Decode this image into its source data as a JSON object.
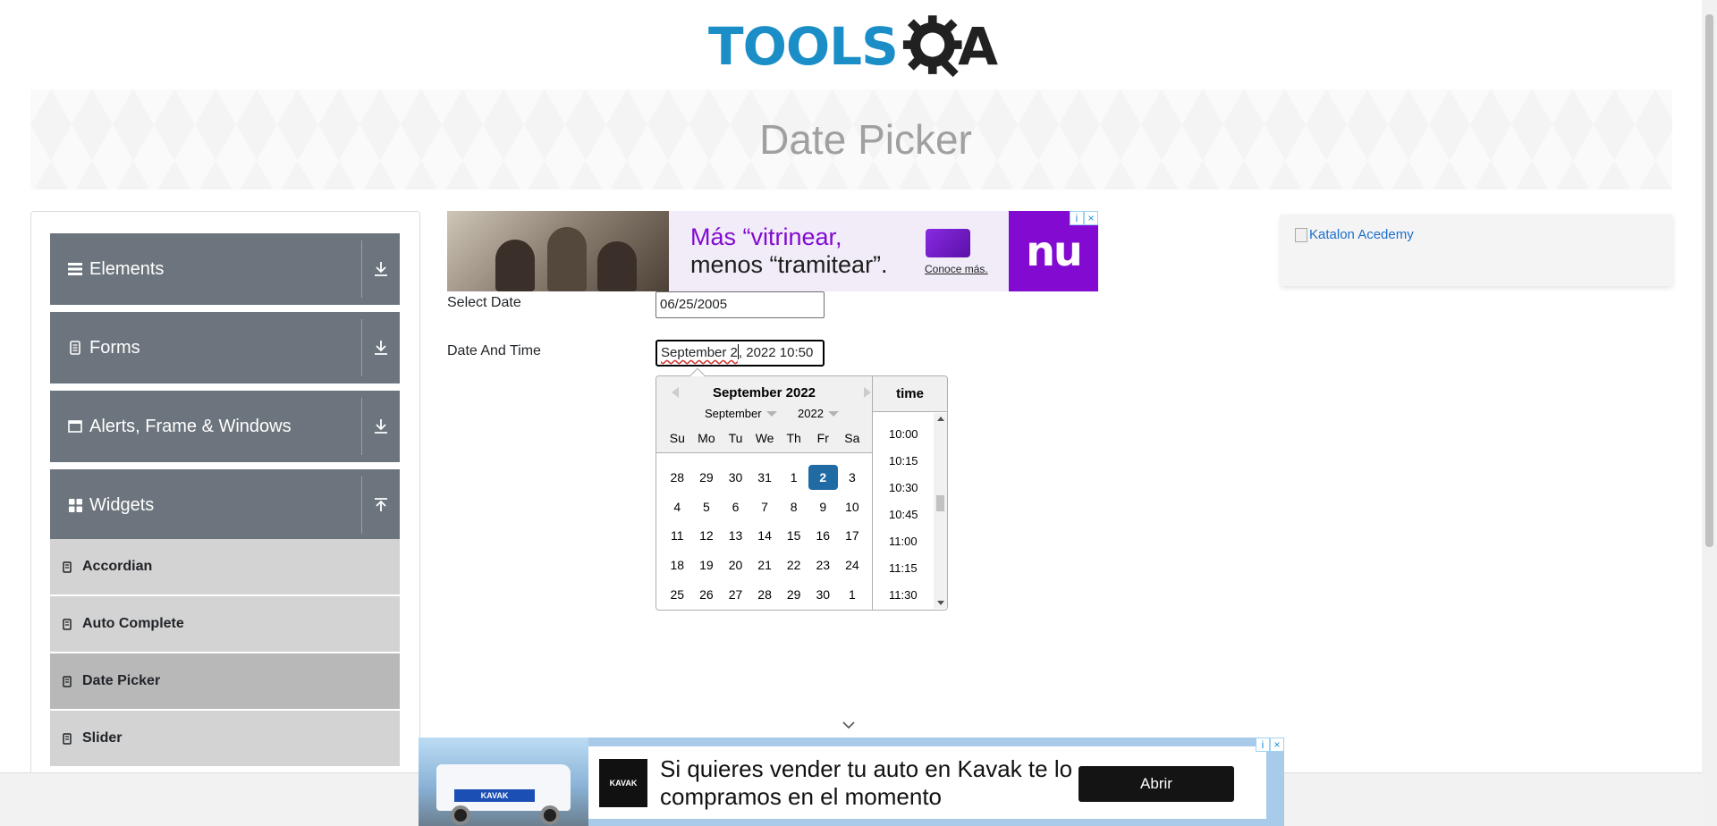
{
  "logo": {
    "text": "TOOLS",
    "suffix": "A"
  },
  "banner": {
    "title": "Date Picker"
  },
  "sidebar": {
    "groups": [
      {
        "label": "Elements",
        "icon": "hamburger-icon",
        "expanded": false
      },
      {
        "label": "Forms",
        "icon": "document-icon",
        "expanded": false
      },
      {
        "label": "Alerts, Frame & Windows",
        "icon": "window-icon",
        "expanded": false
      },
      {
        "label": "Widgets",
        "icon": "grid-icon",
        "expanded": true
      }
    ],
    "widget_items": [
      {
        "label": "Accordian",
        "active": false
      },
      {
        "label": "Auto Complete",
        "active": false
      },
      {
        "label": "Date Picker",
        "active": true
      },
      {
        "label": "Slider",
        "active": false
      }
    ]
  },
  "ad_top": {
    "headline_prefix": "Más “vitrinear,",
    "headline_suffix": "menos “tramitear”.",
    "cta": "Conoce más.",
    "brand": "nu",
    "brand_color": "#820ad1"
  },
  "ad_right": {
    "alt_text": "Katalon Acedemy"
  },
  "form": {
    "select_date_label": "Select Date",
    "select_date_value": "06/25/2005",
    "date_time_label": "Date And Time",
    "date_time_value_before_caret": "September 2",
    "date_time_value_after_caret": ", 2022 10:50"
  },
  "datepicker": {
    "title": "September 2022",
    "month_select": "September",
    "year_select": "2022",
    "weekdays": [
      "Su",
      "Mo",
      "Tu",
      "We",
      "Th",
      "Fr",
      "Sa"
    ],
    "weeks": [
      [
        "28",
        "29",
        "30",
        "31",
        "1",
        "2",
        "3"
      ],
      [
        "4",
        "5",
        "6",
        "7",
        "8",
        "9",
        "10"
      ],
      [
        "11",
        "12",
        "13",
        "14",
        "15",
        "16",
        "17"
      ],
      [
        "18",
        "19",
        "20",
        "21",
        "22",
        "23",
        "24"
      ],
      [
        "25",
        "26",
        "27",
        "28",
        "29",
        "30",
        "1"
      ]
    ],
    "selected_day": "2",
    "selected_color": "#216ba5",
    "time_header": "time",
    "times": [
      "10:00",
      "10:15",
      "10:30",
      "10:45",
      "11:00",
      "11:15",
      "11:30"
    ]
  },
  "ad_bottom": {
    "logo_text": "KAVAK",
    "text": "Si quieres vender tu auto en Kavak te lo compramos en el momento",
    "button": "Abrir"
  },
  "colors": {
    "accent": "#1b8ec7",
    "sidebar_group": "#6c757d",
    "sidebar_item": "#d3d3d3"
  }
}
